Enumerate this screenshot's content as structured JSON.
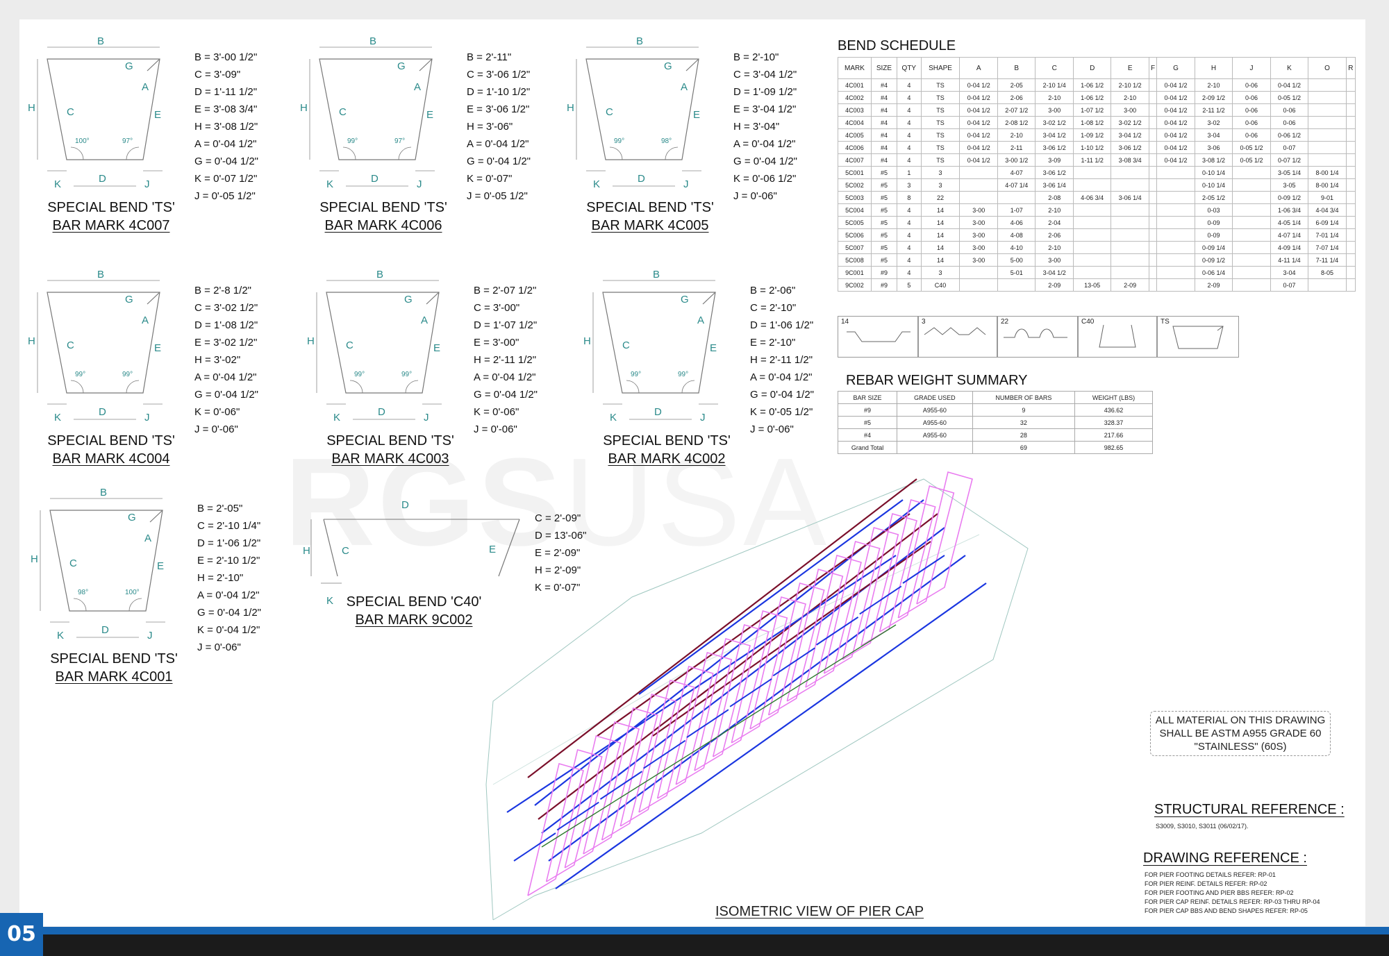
{
  "page_number": "05",
  "watermark": {
    "bold": "RGS",
    "thin": "USA"
  },
  "bends": [
    {
      "caption1": "SPECIAL BEND 'TS'",
      "caption2": "BAR MARK 4C007",
      "angle_left": "100°",
      "angle_right": "97°",
      "dims": [
        "B = 3'-00 1/2\"",
        "C = 3'-09\"",
        "D = 1'-11 1/2\"",
        "E = 3'-08 3/4\"",
        "H = 3'-08 1/2\"",
        "A = 0'-04 1/2\"",
        "G = 0'-04 1/2\"",
        "K = 0'-07 1/2\"",
        "J = 0'-05 1/2\""
      ]
    },
    {
      "caption1": "SPECIAL BEND 'TS'",
      "caption2": "BAR MARK 4C006",
      "angle_left": "99°",
      "angle_right": "97°",
      "dims": [
        "B = 2'-11\"",
        "C = 3'-06 1/2\"",
        "D = 1'-10 1/2\"",
        "E = 3'-06 1/2\"",
        "H = 3'-06\"",
        "A = 0'-04 1/2\"",
        "G = 0'-04 1/2\"",
        "K = 0'-07\"",
        "J = 0'-05 1/2\""
      ]
    },
    {
      "caption1": "SPECIAL BEND 'TS'",
      "caption2": "BAR MARK 4C005",
      "angle_left": "99°",
      "angle_right": "98°",
      "dims": [
        "B = 2'-10\"",
        "C = 3'-04 1/2\"",
        "D = 1'-09 1/2\"",
        "E = 3'-04 1/2\"",
        "H = 3'-04\"",
        "A = 0'-04 1/2\"",
        "G = 0'-04 1/2\"",
        "K = 0'-06 1/2\"",
        "J = 0'-06\""
      ]
    },
    {
      "caption1": "SPECIAL BEND 'TS'",
      "caption2": "BAR MARK 4C004",
      "angle_left": "99°",
      "angle_right": "99°",
      "dims": [
        "B = 2'-8 1/2\"",
        "C = 3'-02 1/2\"",
        "D = 1'-08 1/2\"",
        "E = 3'-02 1/2\"",
        "H = 3'-02\"",
        "A = 0'-04 1/2\"",
        "G = 0'-04 1/2\"",
        "K = 0'-06\"",
        "J = 0'-06\""
      ]
    },
    {
      "caption1": "SPECIAL BEND 'TS'",
      "caption2": "BAR MARK 4C003",
      "angle_left": "99°",
      "angle_right": "99°",
      "dims": [
        "B = 2'-07 1/2\"",
        "C = 3'-00\"",
        "D = 1'-07 1/2\"",
        "E = 3'-00\"",
        "H = 2'-11 1/2\"",
        "A = 0'-04 1/2\"",
        "G = 0'-04 1/2\"",
        "K = 0'-06\"",
        "J = 0'-06\""
      ]
    },
    {
      "caption1": "SPECIAL BEND 'TS'",
      "caption2": "BAR MARK 4C002",
      "angle_left": "99°",
      "angle_right": "99°",
      "dims": [
        "B = 2'-06\"",
        "C = 2'-10\"",
        "D = 1'-06 1/2\"",
        "E = 2'-10\"",
        "H = 2'-11 1/2\"",
        "A = 0'-04 1/2\"",
        "G = 0'-04 1/2\"",
        "K = 0'-05 1/2\"",
        "J = 0'-06\""
      ]
    },
    {
      "caption1": "SPECIAL BEND 'TS'",
      "caption2": "BAR MARK 4C001",
      "angle_left": "98°",
      "angle_right": "100°",
      "dims": [
        "B = 2'-05\"",
        "C = 2'-10 1/4\"",
        "D = 1'-06 1/2\"",
        "E = 2'-10 1/2\"",
        "H = 2'-10\"",
        "A = 0'-04 1/2\"",
        "G = 0'-04 1/2\"",
        "K = 0'-04 1/2\"",
        "J = 0'-06\""
      ]
    }
  ],
  "c40": {
    "caption1": "SPECIAL BEND 'C40'",
    "caption2": "BAR MARK 9C002",
    "dims": [
      "C = 2'-09\"",
      "D = 13'-06\"",
      "E = 2'-09\"",
      "H = 2'-09\"",
      "K = 0'-07\""
    ]
  },
  "bend_schedule": {
    "title": "BEND SCHEDULE",
    "headers": [
      "MARK",
      "SIZE",
      "QTY",
      "SHAPE",
      "A",
      "B",
      "C",
      "D",
      "E",
      "F",
      "G",
      "H",
      "J",
      "K",
      "O",
      "R"
    ],
    "rows": [
      [
        "4C001",
        "#4",
        "4",
        "TS",
        "0-04 1/2",
        "2-05",
        "2-10 1/4",
        "1-06 1/2",
        "2-10 1/2",
        "",
        "0-04 1/2",
        "2-10",
        "0-06",
        "0-04 1/2",
        "",
        ""
      ],
      [
        "4C002",
        "#4",
        "4",
        "TS",
        "0-04 1/2",
        "2-06",
        "2-10",
        "1-06 1/2",
        "2-10",
        "",
        "0-04 1/2",
        "2-09 1/2",
        "0-06",
        "0-05 1/2",
        "",
        ""
      ],
      [
        "4C003",
        "#4",
        "4",
        "TS",
        "0-04 1/2",
        "2-07 1/2",
        "3-00",
        "1-07 1/2",
        "3-00",
        "",
        "0-04 1/2",
        "2-11 1/2",
        "0-06",
        "0-06",
        "",
        ""
      ],
      [
        "4C004",
        "#4",
        "4",
        "TS",
        "0-04 1/2",
        "2-08 1/2",
        "3-02 1/2",
        "1-08 1/2",
        "3-02 1/2",
        "",
        "0-04 1/2",
        "3-02",
        "0-06",
        "0-06",
        "",
        ""
      ],
      [
        "4C005",
        "#4",
        "4",
        "TS",
        "0-04 1/2",
        "2-10",
        "3-04 1/2",
        "1-09 1/2",
        "3-04 1/2",
        "",
        "0-04 1/2",
        "3-04",
        "0-06",
        "0-06 1/2",
        "",
        ""
      ],
      [
        "4C006",
        "#4",
        "4",
        "TS",
        "0-04 1/2",
        "2-11",
        "3-06 1/2",
        "1-10 1/2",
        "3-06 1/2",
        "",
        "0-04 1/2",
        "3-06",
        "0-05 1/2",
        "0-07",
        "",
        ""
      ],
      [
        "4C007",
        "#4",
        "4",
        "TS",
        "0-04 1/2",
        "3-00 1/2",
        "3-09",
        "1-11 1/2",
        "3-08 3/4",
        "",
        "0-04 1/2",
        "3-08 1/2",
        "0-05 1/2",
        "0-07 1/2",
        "",
        ""
      ],
      [
        "5C001",
        "#5",
        "1",
        "3",
        "",
        "4-07",
        "3-06 1/2",
        "",
        "",
        "",
        "",
        "0-10 1/4",
        "",
        "3-05 1/4",
        "8-00 1/4",
        ""
      ],
      [
        "5C002",
        "#5",
        "3",
        "3",
        "",
        "4-07 1/4",
        "3-06 1/4",
        "",
        "",
        "",
        "",
        "0-10 1/4",
        "",
        "3-05",
        "8-00 1/4",
        ""
      ],
      [
        "5C003",
        "#5",
        "8",
        "22",
        "",
        "",
        "2-08",
        "4-06 3/4",
        "3-06 1/4",
        "",
        "",
        "2-05 1/2",
        "",
        "0-09 1/2",
        "9-01",
        ""
      ],
      [
        "5C004",
        "#5",
        "4",
        "14",
        "3-00",
        "1-07",
        "2-10",
        "",
        "",
        "",
        "",
        "0-03",
        "",
        "1-06 3/4",
        "4-04 3/4",
        ""
      ],
      [
        "5C005",
        "#5",
        "4",
        "14",
        "3-00",
        "4-06",
        "2-04",
        "",
        "",
        "",
        "",
        "0-09",
        "",
        "4-05 1/4",
        "6-09 1/4",
        ""
      ],
      [
        "5C006",
        "#5",
        "4",
        "14",
        "3-00",
        "4-08",
        "2-06",
        "",
        "",
        "",
        "",
        "0-09",
        "",
        "4-07 1/4",
        "7-01 1/4",
        ""
      ],
      [
        "5C007",
        "#5",
        "4",
        "14",
        "3-00",
        "4-10",
        "2-10",
        "",
        "",
        "",
        "",
        "0-09 1/4",
        "",
        "4-09 1/4",
        "7-07 1/4",
        ""
      ],
      [
        "5C008",
        "#5",
        "4",
        "14",
        "3-00",
        "5-00",
        "3-00",
        "",
        "",
        "",
        "",
        "0-09 1/2",
        "",
        "4-11 1/4",
        "7-11 1/4",
        ""
      ],
      [
        "9C001",
        "#9",
        "4",
        "3",
        "",
        "5-01",
        "3-04 1/2",
        "",
        "",
        "",
        "",
        "0-06 1/4",
        "",
        "3-04",
        "8-05",
        ""
      ],
      [
        "9C002",
        "#9",
        "5",
        "C40",
        "",
        "",
        "2-09",
        "13-05",
        "2-09",
        "",
        "",
        "2-09",
        "",
        "0-07",
        "",
        ""
      ]
    ]
  },
  "shape_keys": [
    "14",
    "3",
    "22",
    "C40",
    "TS"
  ],
  "weight_summary": {
    "title": "REBAR WEIGHT SUMMARY",
    "headers": [
      "BAR SIZE",
      "GRADE USED",
      "NUMBER OF BARS",
      "WEIGHT (LBS)"
    ],
    "rows": [
      [
        "#9",
        "A955-60",
        "9",
        "436.62"
      ],
      [
        "#5",
        "A955-60",
        "32",
        "328.37"
      ],
      [
        "#4",
        "A955-60",
        "28",
        "217.66"
      ],
      [
        "Grand Total",
        "",
        "69",
        "982.65"
      ]
    ]
  },
  "material_note": [
    "ALL MATERIAL ON THIS DRAWING",
    "SHALL BE ASTM A955 GRADE 60",
    "\"STAINLESS\" (60S)"
  ],
  "structural_reference": {
    "title": "STRUCTURAL REFERENCE :",
    "text": "S3009, S3010, S3011 (06/02/17)."
  },
  "drawing_reference": {
    "title": "DRAWING REFERENCE :",
    "lines": [
      "FOR PIER FOOTING DETAILS REFER: RP-01",
      "FOR PIER REINF. DETAILS REFER: RP-02",
      "FOR PIER FOOTING AND PIER BBS REFER: RP-02",
      "FOR PIER CAP REINF. DETAILS REFER: RP-03 THRU RP-04",
      "FOR PIER CAP BBS AND BEND SHAPES REFER: RP-05"
    ]
  },
  "iso_caption": "ISOMETRIC VIEW OF PIER CAP",
  "colors": {
    "accent_blue": "#1765b2",
    "footer": "#1b1b1b",
    "dim_label": "#2a8a8a",
    "rebar_pink": "#e97cf0",
    "rebar_blue": "#1a36e0",
    "rebar_maroon": "#7a0f2a"
  }
}
